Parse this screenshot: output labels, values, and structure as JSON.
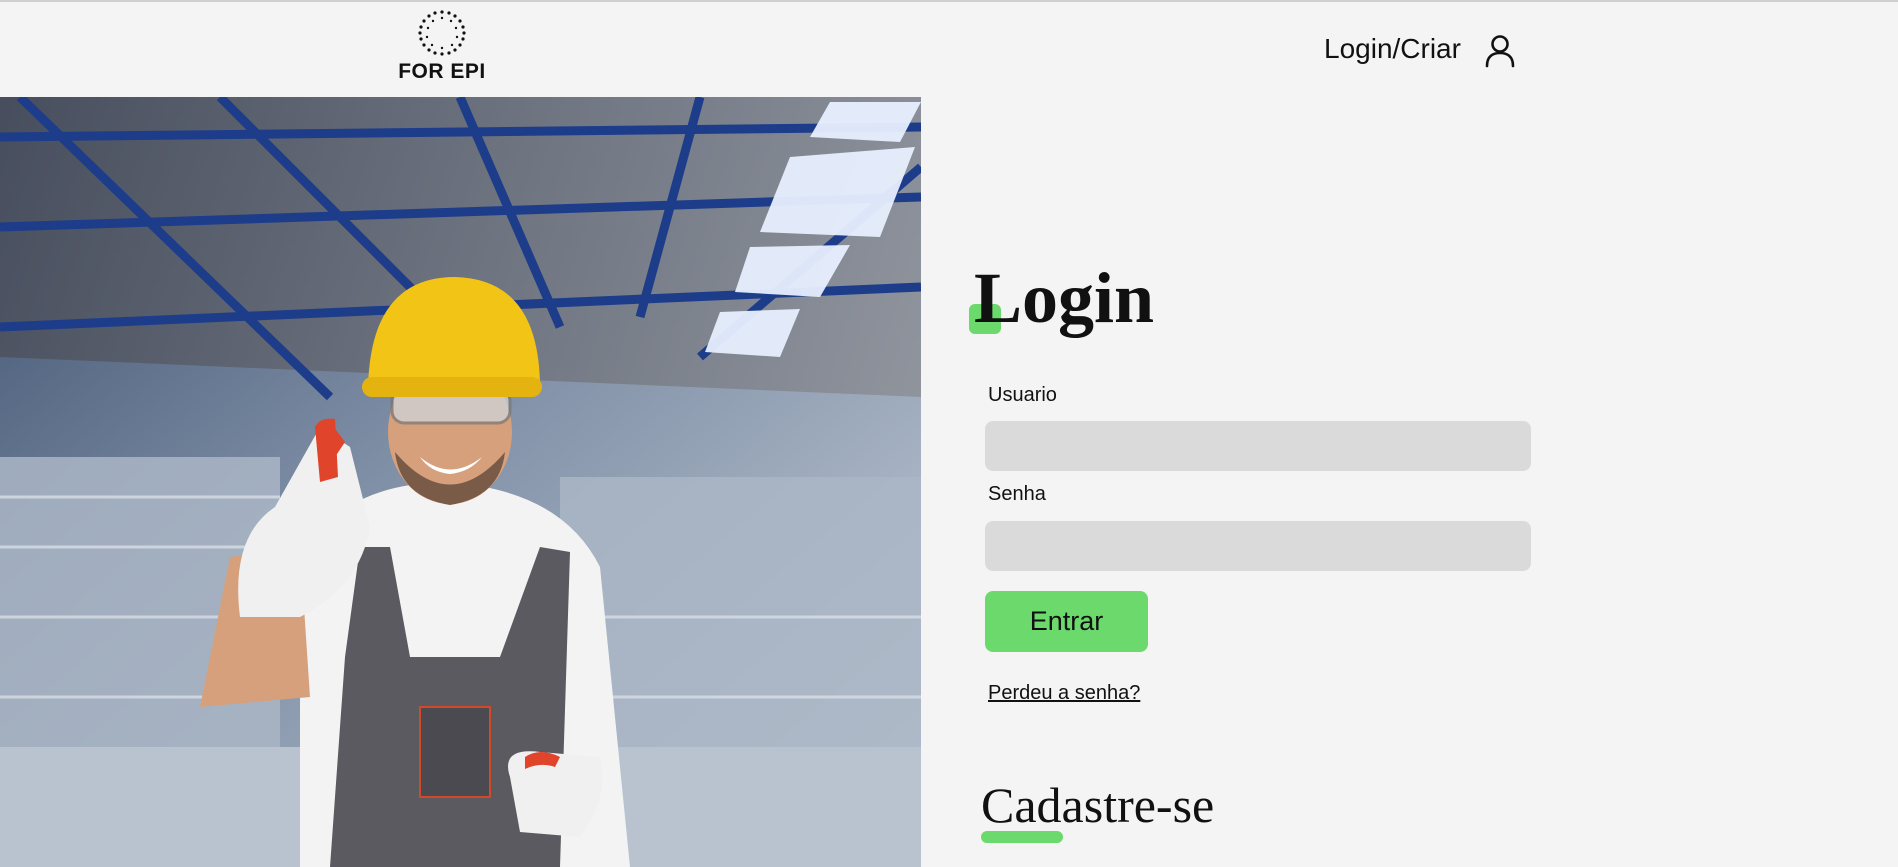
{
  "brand": {
    "logo_text": "FOR EPI",
    "logo_icon": "dotted-ring-logo"
  },
  "header": {
    "login_link": "Login/Criar",
    "user_icon": "user-icon"
  },
  "hero": {
    "image": "worker-with-hard-hat-thumbs-up-photo"
  },
  "login": {
    "title": "Login",
    "username_label": "Usuario",
    "username_value": "",
    "password_label": "Senha",
    "password_value": "",
    "submit_label": "Entrar",
    "forgot_label": "Perdeu a senha?"
  },
  "signup": {
    "title": "Cadastre-se"
  },
  "colors": {
    "accent": "#6bd96b",
    "input_bg": "#dadada",
    "page_bg": "#f4f4f4",
    "text": "#111111"
  }
}
